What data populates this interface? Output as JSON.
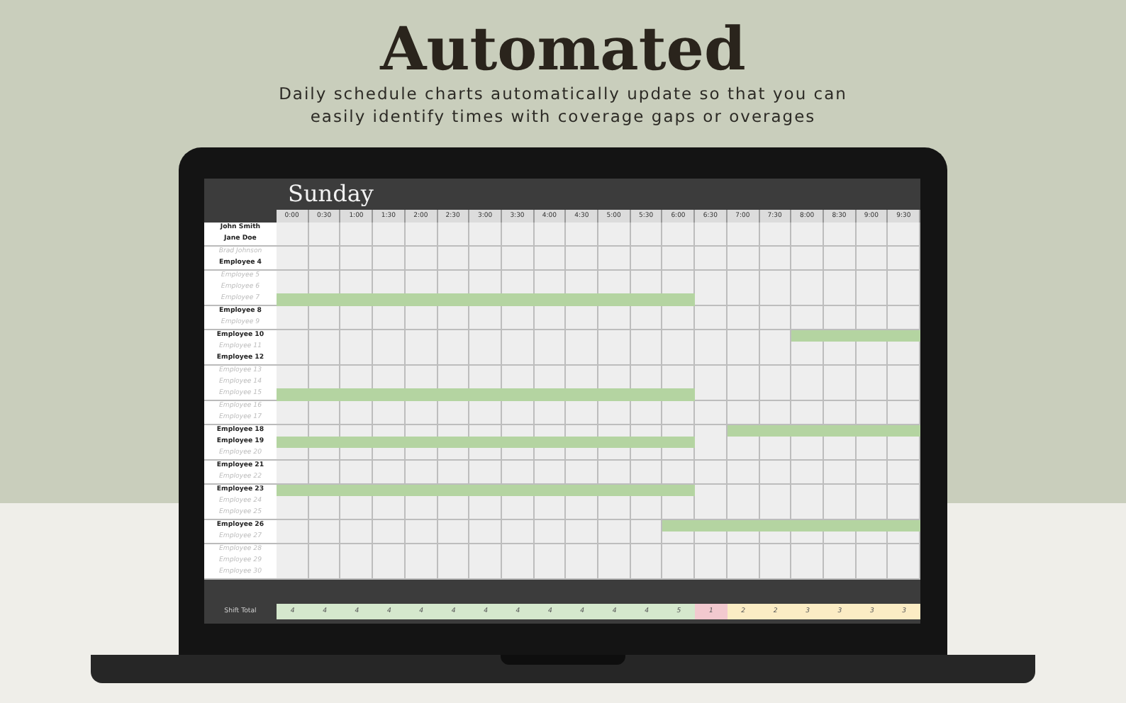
{
  "heading": "Automated",
  "subtitle": "Daily schedule charts automatically update so that you can easily identify times with coverage gaps or overages",
  "sheet": {
    "day": "Sunday",
    "times": [
      "0:00",
      "0:30",
      "1:00",
      "1:30",
      "2:00",
      "2:30",
      "3:00",
      "3:30",
      "4:00",
      "4:30",
      "5:00",
      "5:30",
      "6:00",
      "6:30",
      "7:00",
      "7:30",
      "8:00",
      "8:30",
      "9:00",
      "9:30"
    ],
    "employees": [
      {
        "name": "John Smith",
        "active": true,
        "shift": [
          false,
          false,
          false,
          false,
          false,
          false,
          false,
          false,
          false,
          false,
          false,
          false,
          false,
          false,
          false,
          false,
          false,
          false,
          false,
          false
        ]
      },
      {
        "name": "Jane Doe",
        "active": true,
        "shift": [
          false,
          false,
          false,
          false,
          false,
          false,
          false,
          false,
          false,
          false,
          false,
          false,
          false,
          false,
          false,
          false,
          false,
          false,
          false,
          false
        ]
      },
      {
        "name": "Brad Johnson",
        "active": false,
        "shift": [
          false,
          false,
          false,
          false,
          false,
          false,
          false,
          false,
          false,
          false,
          false,
          false,
          false,
          false,
          false,
          false,
          false,
          false,
          false,
          false
        ]
      },
      {
        "name": "Employee 4",
        "active": true,
        "shift": [
          false,
          false,
          false,
          false,
          false,
          false,
          false,
          false,
          false,
          false,
          false,
          false,
          false,
          false,
          false,
          false,
          false,
          false,
          false,
          false
        ]
      },
      {
        "name": "Employee 5",
        "active": false,
        "shift": [
          false,
          false,
          false,
          false,
          false,
          false,
          false,
          false,
          false,
          false,
          false,
          false,
          false,
          false,
          false,
          false,
          false,
          false,
          false,
          false
        ]
      },
      {
        "name": "Employee 6",
        "active": false,
        "shift": [
          false,
          false,
          false,
          false,
          false,
          false,
          false,
          false,
          false,
          false,
          false,
          false,
          false,
          false,
          false,
          false,
          false,
          false,
          false,
          false
        ]
      },
      {
        "name": "Employee 7",
        "active": false,
        "shift": [
          true,
          true,
          true,
          true,
          true,
          true,
          true,
          true,
          true,
          true,
          true,
          true,
          true,
          false,
          false,
          false,
          false,
          false,
          false,
          false
        ]
      },
      {
        "name": "Employee 8",
        "active": true,
        "shift": [
          false,
          false,
          false,
          false,
          false,
          false,
          false,
          false,
          false,
          false,
          false,
          false,
          false,
          false,
          false,
          false,
          false,
          false,
          false,
          false
        ]
      },
      {
        "name": "Employee 9",
        "active": false,
        "shift": [
          false,
          false,
          false,
          false,
          false,
          false,
          false,
          false,
          false,
          false,
          false,
          false,
          false,
          false,
          false,
          false,
          false,
          false,
          false,
          false
        ]
      },
      {
        "name": "Employee 10",
        "active": true,
        "shift": [
          false,
          false,
          false,
          false,
          false,
          false,
          false,
          false,
          false,
          false,
          false,
          false,
          false,
          false,
          false,
          false,
          true,
          true,
          true,
          true
        ]
      },
      {
        "name": "Employee 11",
        "active": false,
        "shift": [
          false,
          false,
          false,
          false,
          false,
          false,
          false,
          false,
          false,
          false,
          false,
          false,
          false,
          false,
          false,
          false,
          false,
          false,
          false,
          false
        ]
      },
      {
        "name": "Employee 12",
        "active": true,
        "shift": [
          false,
          false,
          false,
          false,
          false,
          false,
          false,
          false,
          false,
          false,
          false,
          false,
          false,
          false,
          false,
          false,
          false,
          false,
          false,
          false
        ]
      },
      {
        "name": "Employee 13",
        "active": false,
        "shift": [
          false,
          false,
          false,
          false,
          false,
          false,
          false,
          false,
          false,
          false,
          false,
          false,
          false,
          false,
          false,
          false,
          false,
          false,
          false,
          false
        ]
      },
      {
        "name": "Employee 14",
        "active": false,
        "shift": [
          false,
          false,
          false,
          false,
          false,
          false,
          false,
          false,
          false,
          false,
          false,
          false,
          false,
          false,
          false,
          false,
          false,
          false,
          false,
          false
        ]
      },
      {
        "name": "Employee 15",
        "active": false,
        "shift": [
          true,
          true,
          true,
          true,
          true,
          true,
          true,
          true,
          true,
          true,
          true,
          true,
          true,
          false,
          false,
          false,
          false,
          false,
          false,
          false
        ]
      },
      {
        "name": "Employee 16",
        "active": false,
        "shift": [
          false,
          false,
          false,
          false,
          false,
          false,
          false,
          false,
          false,
          false,
          false,
          false,
          false,
          false,
          false,
          false,
          false,
          false,
          false,
          false
        ]
      },
      {
        "name": "Employee 17",
        "active": false,
        "shift": [
          false,
          false,
          false,
          false,
          false,
          false,
          false,
          false,
          false,
          false,
          false,
          false,
          false,
          false,
          false,
          false,
          false,
          false,
          false,
          false
        ]
      },
      {
        "name": "Employee 18",
        "active": true,
        "shift": [
          false,
          false,
          false,
          false,
          false,
          false,
          false,
          false,
          false,
          false,
          false,
          false,
          false,
          false,
          true,
          true,
          true,
          true,
          true,
          true
        ]
      },
      {
        "name": "Employee 19",
        "active": true,
        "shift": [
          true,
          true,
          true,
          true,
          true,
          true,
          true,
          true,
          true,
          true,
          true,
          true,
          true,
          false,
          false,
          false,
          false,
          false,
          false,
          false
        ]
      },
      {
        "name": "Employee 20",
        "active": false,
        "shift": [
          false,
          false,
          false,
          false,
          false,
          false,
          false,
          false,
          false,
          false,
          false,
          false,
          false,
          false,
          false,
          false,
          false,
          false,
          false,
          false
        ]
      },
      {
        "name": "Employee 21",
        "active": true,
        "shift": [
          false,
          false,
          false,
          false,
          false,
          false,
          false,
          false,
          false,
          false,
          false,
          false,
          false,
          false,
          false,
          false,
          false,
          false,
          false,
          false
        ]
      },
      {
        "name": "Employee 22",
        "active": false,
        "shift": [
          false,
          false,
          false,
          false,
          false,
          false,
          false,
          false,
          false,
          false,
          false,
          false,
          false,
          false,
          false,
          false,
          false,
          false,
          false,
          false
        ]
      },
      {
        "name": "Employee 23",
        "active": true,
        "shift": [
          true,
          true,
          true,
          true,
          true,
          true,
          true,
          true,
          true,
          true,
          true,
          true,
          true,
          false,
          false,
          false,
          false,
          false,
          false,
          false
        ]
      },
      {
        "name": "Employee 24",
        "active": false,
        "shift": [
          false,
          false,
          false,
          false,
          false,
          false,
          false,
          false,
          false,
          false,
          false,
          false,
          false,
          false,
          false,
          false,
          false,
          false,
          false,
          false
        ]
      },
      {
        "name": "Employee 25",
        "active": false,
        "shift": [
          false,
          false,
          false,
          false,
          false,
          false,
          false,
          false,
          false,
          false,
          false,
          false,
          false,
          false,
          false,
          false,
          false,
          false,
          false,
          false
        ]
      },
      {
        "name": "Employee 26",
        "active": true,
        "shift": [
          false,
          false,
          false,
          false,
          false,
          false,
          false,
          false,
          false,
          false,
          false,
          false,
          true,
          true,
          true,
          true,
          true,
          true,
          true,
          true
        ]
      },
      {
        "name": "Employee 27",
        "active": false,
        "shift": [
          false,
          false,
          false,
          false,
          false,
          false,
          false,
          false,
          false,
          false,
          false,
          false,
          false,
          false,
          false,
          false,
          false,
          false,
          false,
          false
        ]
      },
      {
        "name": "Employee 28",
        "active": false,
        "shift": [
          false,
          false,
          false,
          false,
          false,
          false,
          false,
          false,
          false,
          false,
          false,
          false,
          false,
          false,
          false,
          false,
          false,
          false,
          false,
          false
        ]
      },
      {
        "name": "Employee 29",
        "active": false,
        "shift": [
          false,
          false,
          false,
          false,
          false,
          false,
          false,
          false,
          false,
          false,
          false,
          false,
          false,
          false,
          false,
          false,
          false,
          false,
          false,
          false
        ]
      },
      {
        "name": "Employee 30",
        "active": false,
        "shift": [
          false,
          false,
          false,
          false,
          false,
          false,
          false,
          false,
          false,
          false,
          false,
          false,
          false,
          false,
          false,
          false,
          false,
          false,
          false,
          false
        ]
      }
    ],
    "total_label": "Shift Total",
    "totals": [
      {
        "value": "4",
        "color": "#d5e8cd"
      },
      {
        "value": "4",
        "color": "#d5e8cd"
      },
      {
        "value": "4",
        "color": "#d5e8cd"
      },
      {
        "value": "4",
        "color": "#d5e8cd"
      },
      {
        "value": "4",
        "color": "#d5e8cd"
      },
      {
        "value": "4",
        "color": "#d5e8cd"
      },
      {
        "value": "4",
        "color": "#d5e8cd"
      },
      {
        "value": "4",
        "color": "#d5e8cd"
      },
      {
        "value": "4",
        "color": "#d5e8cd"
      },
      {
        "value": "4",
        "color": "#d5e8cd"
      },
      {
        "value": "4",
        "color": "#d5e8cd"
      },
      {
        "value": "4",
        "color": "#d5e8cd"
      },
      {
        "value": "5",
        "color": "#d5e8cd"
      },
      {
        "value": "1",
        "color": "#f2c9cf"
      },
      {
        "value": "2",
        "color": "#fbecc4"
      },
      {
        "value": "2",
        "color": "#fbecc4"
      },
      {
        "value": "3",
        "color": "#fbecc4"
      },
      {
        "value": "3",
        "color": "#fbecc4"
      },
      {
        "value": "3",
        "color": "#fbecc4"
      },
      {
        "value": "3",
        "color": "#fbecc4"
      }
    ]
  }
}
